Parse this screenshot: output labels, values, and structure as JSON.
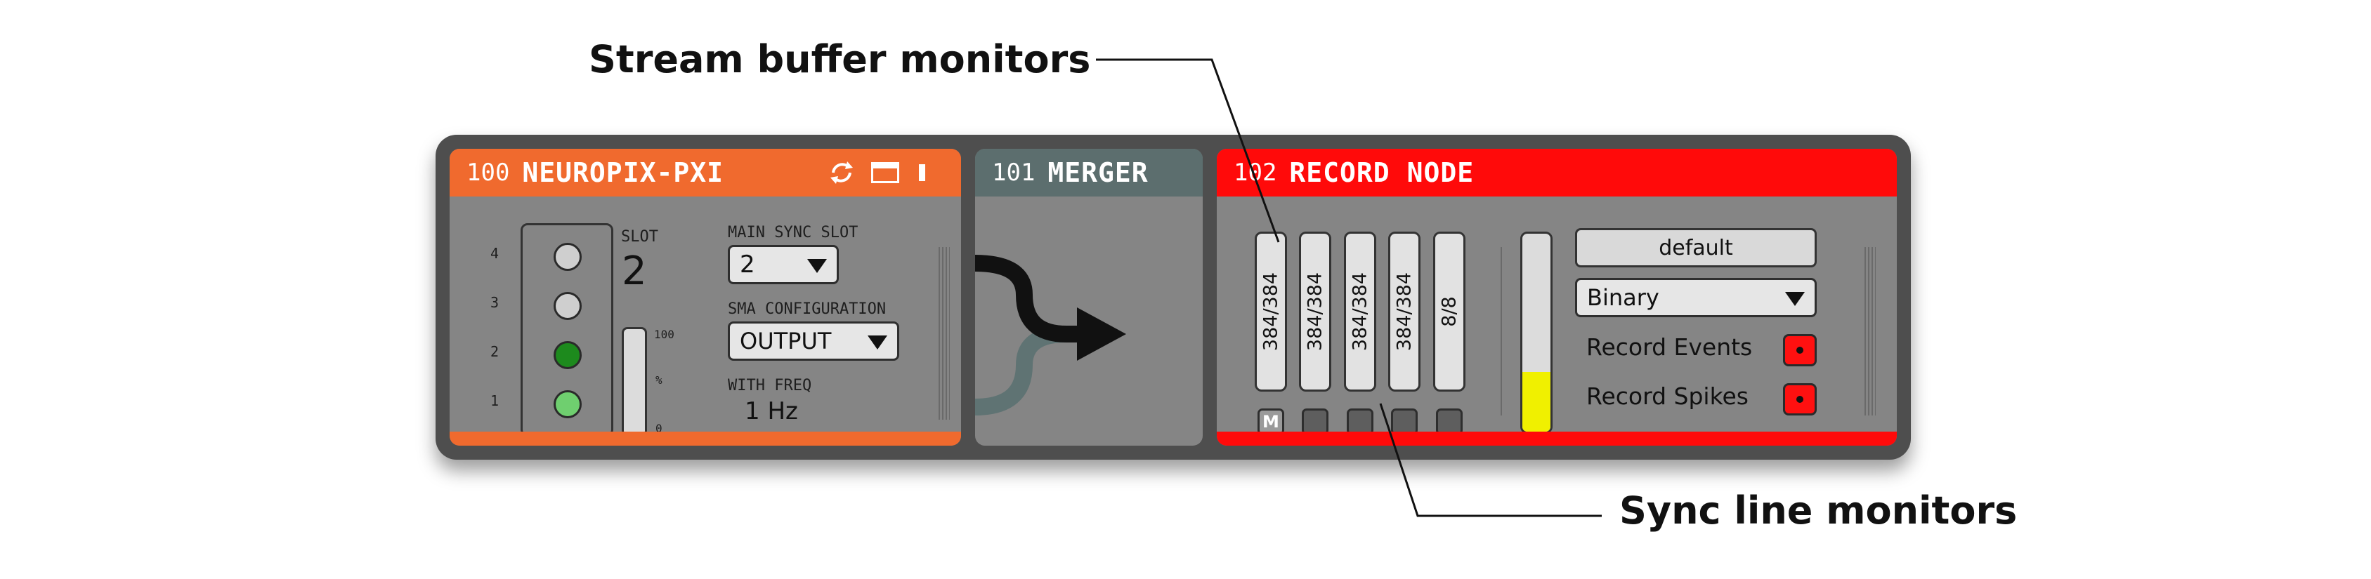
{
  "annotations": {
    "stream_buffer": "Stream buffer monitors",
    "sync_line": "Sync line monitors"
  },
  "nodes": {
    "neuropix": {
      "id": "100",
      "name": "NEUROPIX-PXI",
      "color": "#f06a2e",
      "icons": [
        "refresh-icon",
        "window-icon",
        "menu-toggle-icon"
      ],
      "slot_numbers": [
        "4",
        "3",
        "2",
        "1"
      ],
      "slot_label": "SLOT",
      "slot_value": "2",
      "level_scale": [
        "100",
        "%",
        "0"
      ],
      "main_sync_slot_label": "MAIN SYNC SLOT",
      "main_sync_slot_value": "2",
      "sma_config_label": "SMA CONFIGURATION",
      "sma_config_value": "OUTPUT",
      "with_freq_label": "WITH FREQ",
      "freq_value": "1 Hz",
      "probe_status_colors": [
        "#cfcfcf",
        "#cfcfcf",
        "#1d8a1d",
        "#6fcf6f"
      ]
    },
    "merger": {
      "id": "101",
      "name": "MERGER",
      "color": "#5c6e6e"
    },
    "record": {
      "id": "102",
      "name": "RECORD NODE",
      "color": "#ff0a0a",
      "buffers": [
        "384/384",
        "384/384",
        "384/384",
        "384/384",
        "8/8"
      ],
      "sync_lines": [
        "M",
        "",
        "",
        "",
        ""
      ],
      "disk_fill_percent": 30,
      "disk_fill_color": "#f0f000",
      "directory_button": "default",
      "format_value": "Binary",
      "record_events_label": "Record Events",
      "record_spikes_label": "Record Spikes"
    }
  }
}
